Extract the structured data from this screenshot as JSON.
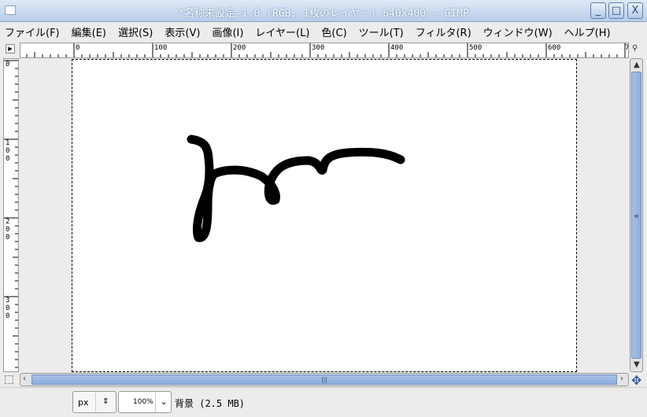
{
  "window": {
    "title": "*名称未設定-1.0 (RGB, 1枚のレイヤー) 640x400 - GIMP",
    "minimize": "_",
    "maximize": "□",
    "close": "X"
  },
  "menu": [
    "ファイル(F)",
    "編集(E)",
    "選択(S)",
    "表示(V)",
    "画像(I)",
    "レイヤー(L)",
    "色(C)",
    "ツール(T)",
    "フィルタ(R)",
    "ウィンドウ(W)",
    "ヘルプ(H)"
  ],
  "hruler": [
    "0",
    "100",
    "200",
    "300",
    "400",
    "500",
    "600",
    "7"
  ],
  "vruler": [
    "0",
    "100",
    "200",
    "300"
  ],
  "status": {
    "unit": "px",
    "zoom": "100%",
    "layer": "背景 (2.5 MB)"
  }
}
